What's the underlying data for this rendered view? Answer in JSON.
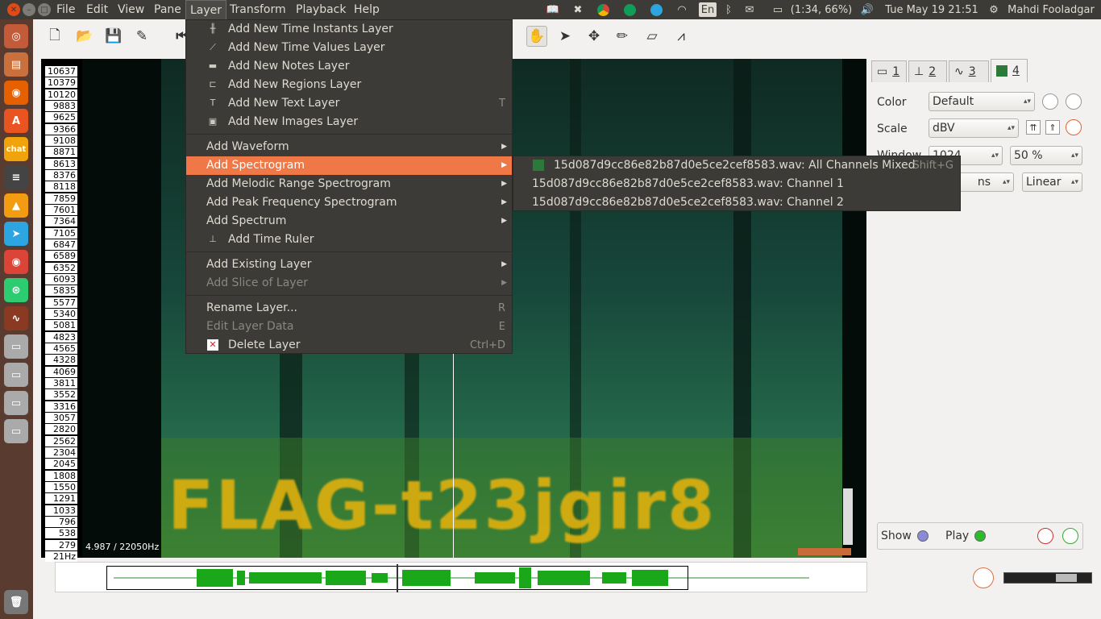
{
  "topbar": {
    "menus": [
      "File",
      "Edit",
      "View",
      "Pane",
      "Layer",
      "Transform",
      "Playback",
      "Help"
    ],
    "keyboard": "En",
    "battery": "(1:34, 66%)",
    "clock": "Tue May 19 21:51",
    "user": "Mahdi Fooladgar"
  },
  "ruler": {
    "ticks": [
      "10637",
      "10379",
      "10120",
      "9883",
      "9625",
      "9366",
      "9108",
      "8871",
      "8613",
      "8376",
      "8118",
      "7859",
      "7601",
      "7364",
      "7105",
      "6847",
      "6589",
      "6352",
      "6093",
      "5835",
      "5577",
      "5340",
      "5081",
      "4823",
      "4565",
      "4328",
      "4069",
      "3811",
      "3552",
      "3316",
      "3057",
      "2820",
      "2562",
      "2304",
      "2045",
      "1808",
      "1550",
      "1291",
      "1033",
      "796",
      "538",
      "279",
      "21Hz"
    ]
  },
  "spectrogram": {
    "overlay_text": "FLAG-t23jgir8",
    "coords": "4.987 / 22050Hz"
  },
  "panel": {
    "tabs": [
      "1",
      "2",
      "3",
      "4"
    ],
    "color_label": "Color",
    "color_value": "Default",
    "scale_label": "Scale",
    "scale_value": "dBV",
    "window_label": "Window",
    "window_value": "1024",
    "overlap_value": "50 %",
    "bins_value": "ns",
    "freq_scale_value": "Linear",
    "show_label": "Show",
    "play_label": "Play"
  },
  "layer_menu": {
    "items": [
      {
        "label": "Add New Time Instants Layer",
        "shortcut": ""
      },
      {
        "label": "Add New Time Values Layer",
        "shortcut": ""
      },
      {
        "label": "Add New Notes Layer",
        "shortcut": ""
      },
      {
        "label": "Add New Regions Layer",
        "shortcut": ""
      },
      {
        "label": "Add New Text Layer",
        "shortcut": "T"
      },
      {
        "label": "Add New Images Layer",
        "shortcut": ""
      },
      {
        "label": "Add Waveform",
        "shortcut": ""
      },
      {
        "label": "Add Spectrogram",
        "shortcut": ""
      },
      {
        "label": "Add Melodic Range Spectrogram",
        "shortcut": ""
      },
      {
        "label": "Add Peak Frequency Spectrogram",
        "shortcut": ""
      },
      {
        "label": "Add Spectrum",
        "shortcut": ""
      },
      {
        "label": "Add Time Ruler",
        "shortcut": ""
      },
      {
        "label": "Add Existing Layer",
        "shortcut": ""
      },
      {
        "label": "Add Slice of Layer",
        "shortcut": ""
      },
      {
        "label": "Rename Layer...",
        "shortcut": "R"
      },
      {
        "label": "Edit Layer Data",
        "shortcut": "E"
      },
      {
        "label": "Delete Layer",
        "shortcut": "Ctrl+D"
      }
    ]
  },
  "submenu": {
    "items": [
      {
        "label": "15d087d9cc86e82b87d0e5ce2cef8583.wav: All Channels Mixed",
        "shortcut": "Shift+G"
      },
      {
        "label": "15d087d9cc86e82b87d0e5ce2cef8583.wav: Channel 1",
        "shortcut": ""
      },
      {
        "label": "15d087d9cc86e82b87d0e5ce2cef8583.wav: Channel 2",
        "shortcut": ""
      }
    ]
  },
  "colors": {
    "accent": "#f07746",
    "menu_bg": "#3c3b37",
    "launcher": "#5a3b2f",
    "flag": "#e0b10f"
  }
}
